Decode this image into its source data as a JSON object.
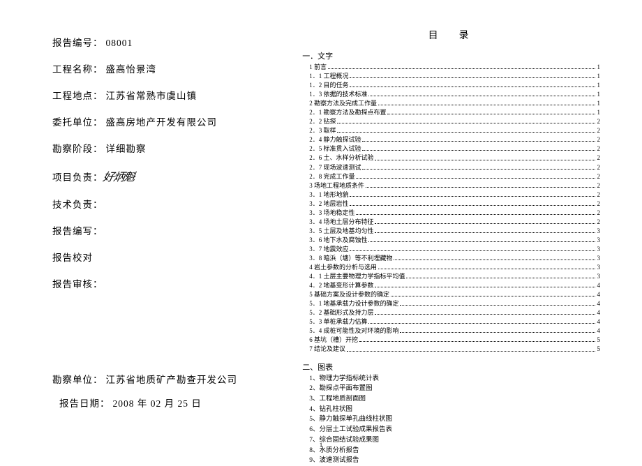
{
  "cover": {
    "report_no_label": "报告编号：",
    "report_no_value": "08001",
    "project_name_label": "工程名称：",
    "project_name_value": "盛高怡景湾",
    "project_site_label": "工程地点：",
    "project_site_value": "江苏省常熟市虞山镇",
    "client_label": "委托单位：",
    "client_value": "盛高房地产开发有限公司",
    "survey_stage_label": "勘察阶段：",
    "survey_stage_value": "详细勘察",
    "project_lead_label": "项目负责：",
    "project_lead_signature": "好炳魁",
    "tech_lead_label": "技术负责：",
    "report_writer_label": "报告编写：",
    "report_proof_label": "报告校对",
    "report_review_label": "报告审核：",
    "survey_unit_label": "勘察单位：",
    "survey_unit_value": "江苏省地质矿产勘查开发公司",
    "report_date_label": "报告日期：",
    "report_date_value": "2008 年 02 月 25 日"
  },
  "toc": {
    "title": "目　录",
    "section1_head": "一．文字",
    "items": [
      {
        "label": "1 前言",
        "page": "1",
        "indent": 0
      },
      {
        "label": "1．1 工程概况",
        "page": "1",
        "indent": 1
      },
      {
        "label": "1．2 目的任务",
        "page": "1",
        "indent": 1
      },
      {
        "label": "1．3 依据的技术标准",
        "page": "1",
        "indent": 1
      },
      {
        "label": "2 勘察方法及完成工作量",
        "page": "1",
        "indent": 0
      },
      {
        "label": "2．1 勘察方法及勘探点布置",
        "page": "1",
        "indent": 1
      },
      {
        "label": "2．2 钻探",
        "page": "2",
        "indent": 1
      },
      {
        "label": "2．3 取样",
        "page": "2",
        "indent": 1
      },
      {
        "label": "2．4 静力触探试验",
        "page": "2",
        "indent": 1
      },
      {
        "label": "2．5 标准贯入试验",
        "page": "2",
        "indent": 1
      },
      {
        "label": "2．6 土、水样分析试验",
        "page": "2",
        "indent": 1
      },
      {
        "label": "2．7 现场波速测试",
        "page": "2",
        "indent": 1
      },
      {
        "label": "2．8 完成工作量",
        "page": "2",
        "indent": 1
      },
      {
        "label": "3 场地工程地质条件",
        "page": "2",
        "indent": 0
      },
      {
        "label": "3．1 地形地貌",
        "page": "2",
        "indent": 1
      },
      {
        "label": "3．2 地层岩性",
        "page": "2",
        "indent": 1
      },
      {
        "label": "3．3 场地稳定性",
        "page": "2",
        "indent": 1
      },
      {
        "label": "3．4 场地土层分布特征",
        "page": "2",
        "indent": 1
      },
      {
        "label": "3．5 土层及地基均匀性",
        "page": "3",
        "indent": 1
      },
      {
        "label": "3．6 地下水及腐蚀性",
        "page": "3",
        "indent": 1
      },
      {
        "label": "3．7 地震效应",
        "page": "3",
        "indent": 1
      },
      {
        "label": "3．8 暗浜（塘）等不利埋藏物",
        "page": "3",
        "indent": 1
      },
      {
        "label": "4 岩土参数的分析与选用",
        "page": "3",
        "indent": 0
      },
      {
        "label": "4．1 土层主要物理力学指标平均值",
        "page": "3",
        "indent": 1
      },
      {
        "label": "4．2 地基变形计算参数",
        "page": "4",
        "indent": 1
      },
      {
        "label": "5 基础方案及设计参数的确定",
        "page": "4",
        "indent": 0
      },
      {
        "label": "5．1 地基承载力设计参数的确定",
        "page": "4",
        "indent": 1
      },
      {
        "label": "5．2 基础形式及持力层",
        "page": "4",
        "indent": 1
      },
      {
        "label": "5．3 单桩承载力估算",
        "page": "4",
        "indent": 1
      },
      {
        "label": "5．4 成桩可能性及对环境的影响",
        "page": "4",
        "indent": 1
      },
      {
        "label": "6 基坑（槽）开挖",
        "page": "5",
        "indent": 0
      },
      {
        "label": "7 结论及建议",
        "page": "5",
        "indent": 0
      }
    ],
    "section2_head": "二、图表",
    "figures": [
      "1、物理力学指标统计表",
      "2、勘探点平面布置图",
      "3、工程地质剖面图",
      "4、钻孔柱状图",
      "5、静力触探单孔曲线柱状图",
      "6、分层土工试验成果报告表",
      "7、综合固结试验成果图",
      "8、水质分析报告",
      "9、波速测试报告"
    ]
  },
  "page_number": "1"
}
